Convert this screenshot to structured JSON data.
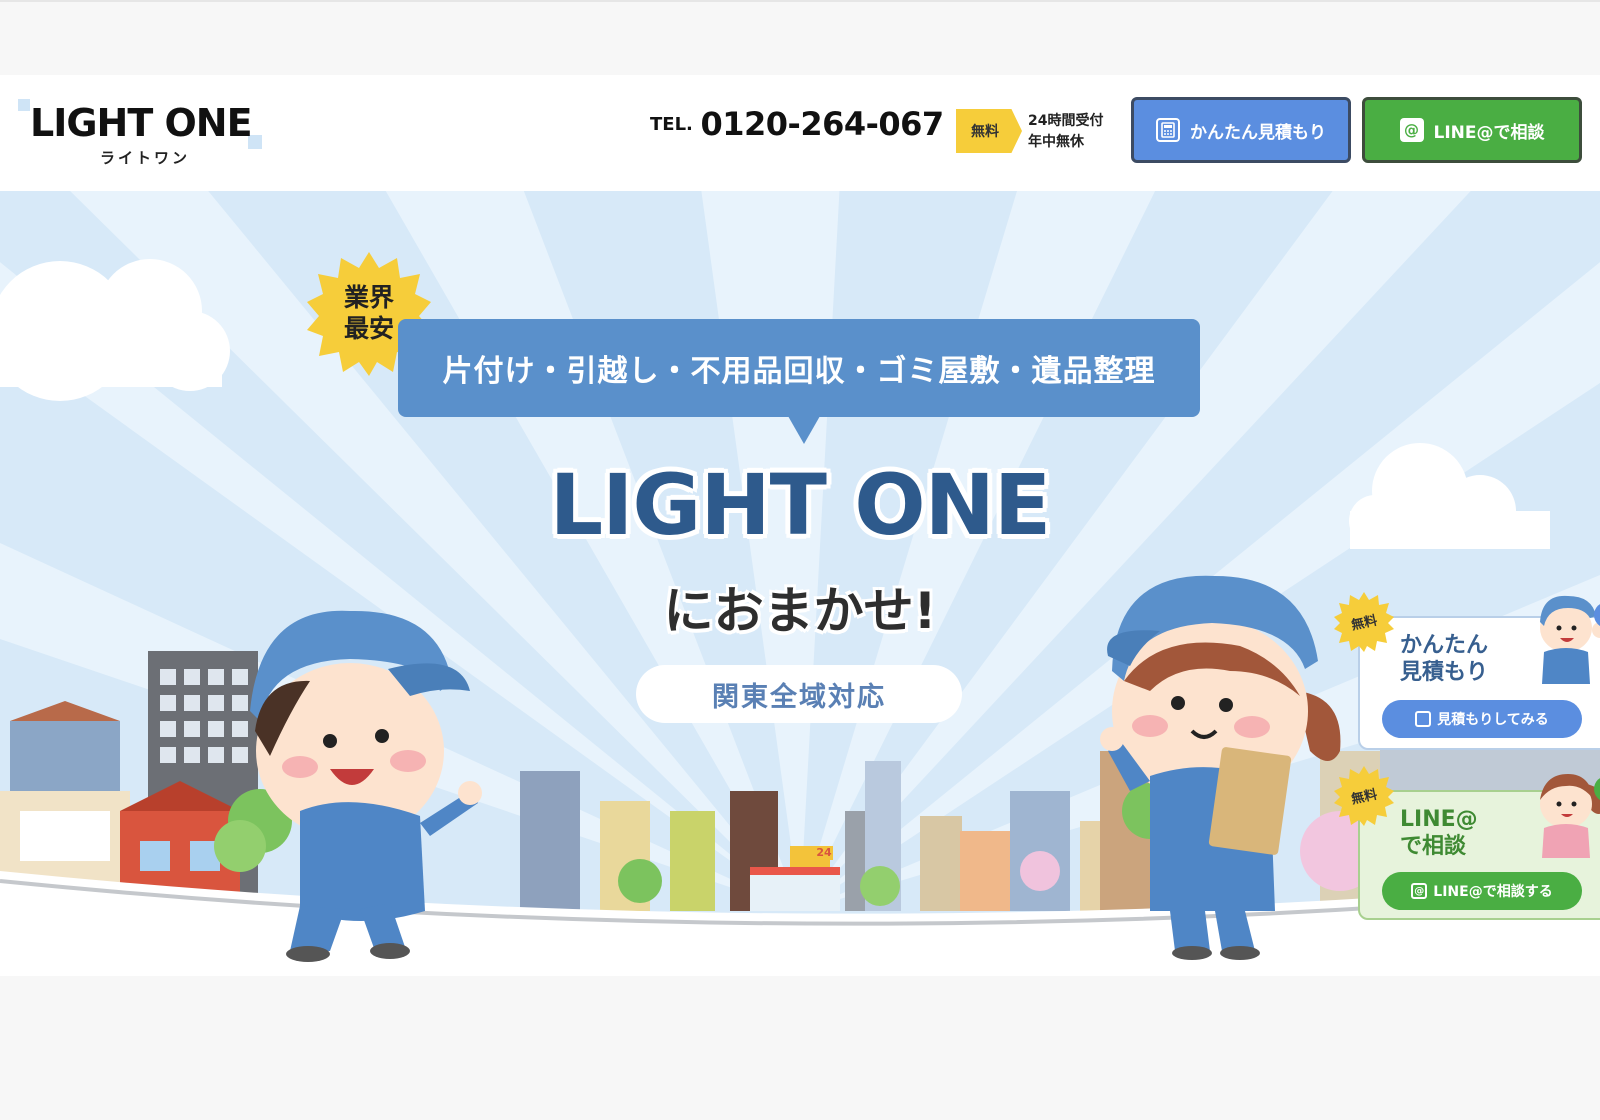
{
  "header": {
    "logo": {
      "wordmark": "LIGHT ONE",
      "kana": "ライトワン"
    },
    "tel": {
      "prefix": "TEL.",
      "number": "0120-264-067"
    },
    "free_tag": "無料",
    "hours": {
      "line1": "24時間受付",
      "line2": "年中無休"
    },
    "estimate_button": "かんたん見積もり",
    "line_button": "LINE@で相談"
  },
  "hero": {
    "badge": {
      "line1": "業界",
      "line2": "最安"
    },
    "services": "片付け・引越し・不用品回収・ゴミ屋敷・遺品整理",
    "title": "LIGHT ONE",
    "subtitle": "におまかせ!",
    "area": "関東全域対応",
    "shop_sign": "24"
  },
  "side_widgets": {
    "estimate": {
      "free": "無料",
      "title_l1": "かんたん",
      "title_l2": "見積もり",
      "button": "見積もりしてみる",
      "close": "×"
    },
    "line": {
      "free": "無料",
      "title_l1": "LINE@",
      "title_l2": "で相談",
      "button": "LINE@で相談する",
      "close": "×"
    }
  },
  "colors": {
    "brand_blue": "#5a90cb",
    "title_navy": "#2e5a8c",
    "line_green": "#4aae43",
    "badge_yellow": "#f6cd3a",
    "sky": "#d7e9f8"
  }
}
